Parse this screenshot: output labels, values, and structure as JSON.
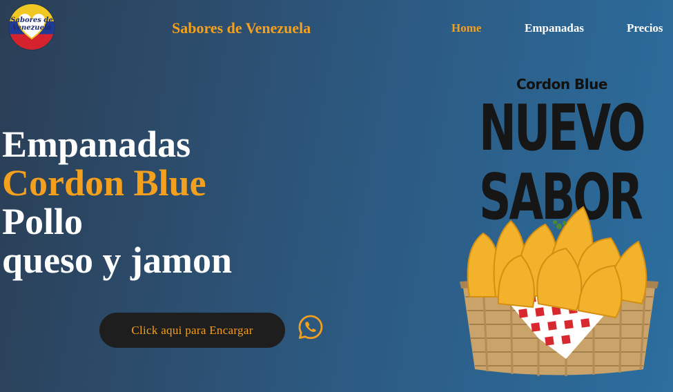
{
  "header": {
    "logo_text_line1": "Sabores de",
    "logo_text_line2": "Venezuela",
    "brand": "Sabores de Venezuela",
    "nav": [
      {
        "label": "Home",
        "active": true
      },
      {
        "label": "Empanadas",
        "active": false
      },
      {
        "label": "Precios",
        "active": false
      }
    ]
  },
  "hero": {
    "line1": "Empanadas",
    "line2": "Cordon Blue",
    "line3": "Pollo",
    "line4": "queso y jamon"
  },
  "cta": {
    "label": "Click aqui para Encargar",
    "icon": "whatsapp-icon"
  },
  "promo": {
    "subtitle": "Cordon Blue",
    "line1": "NUEVO",
    "line2": "SABOR"
  },
  "colors": {
    "accent": "#f3a01f",
    "bg_start": "#2b3e55",
    "bg_end": "#2c6e9f",
    "button_bg": "#1e1e1e"
  }
}
